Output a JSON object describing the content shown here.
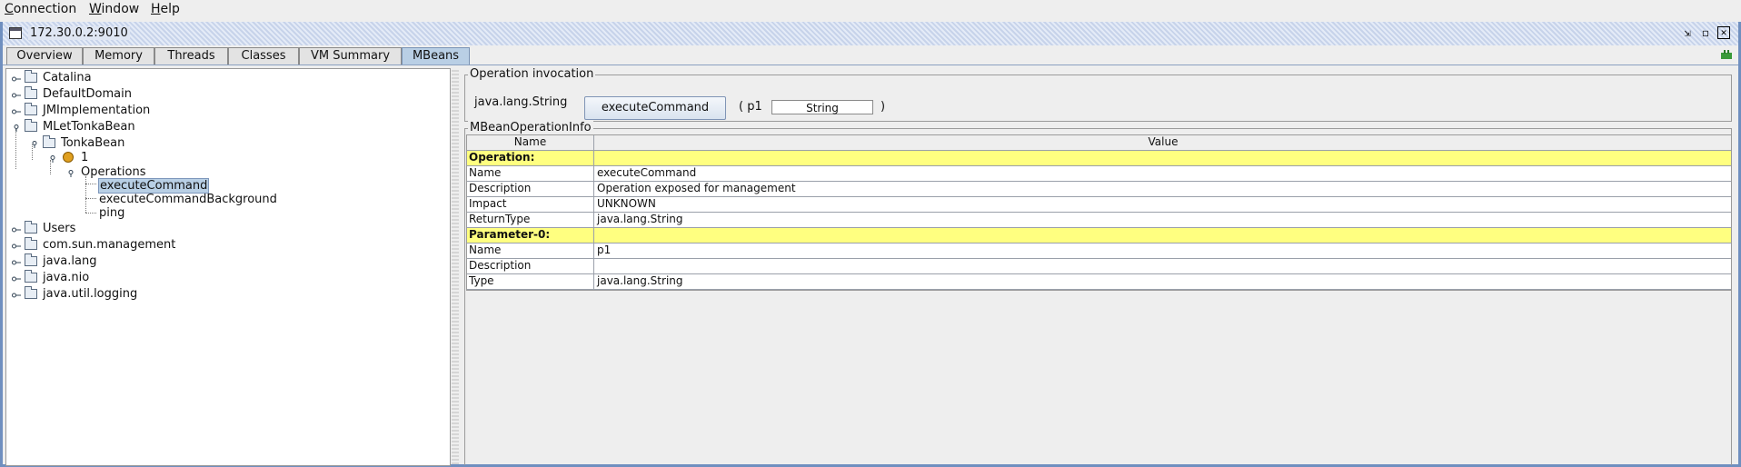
{
  "menubar": {
    "items": [
      "Connection",
      "Window",
      "Help"
    ]
  },
  "window": {
    "title": "172.30.0.2:9010"
  },
  "tabs": [
    "Overview",
    "Memory",
    "Threads",
    "Classes",
    "VM Summary",
    "MBeans"
  ],
  "selected_tab": "MBeans",
  "tree": {
    "catalina": "Catalina",
    "default_domain": "DefaultDomain",
    "jmimpl": "JMImplementation",
    "mlet": "MLetTonkaBean",
    "tonka": "TonkaBean",
    "one": "1",
    "operations": "Operations",
    "execute": "executeCommand",
    "execute_bg": "executeCommandBackground",
    "ping": "ping",
    "users": "Users",
    "com_sun": "com.sun.management",
    "java_lang": "java.lang",
    "java_nio": "java.nio",
    "java_util_logging": "java.util.logging"
  },
  "invocation": {
    "title": "Operation invocation",
    "return_type": "java.lang.String",
    "button_label": "executeCommand",
    "open": "( p1",
    "param_value": "String",
    "close": ")"
  },
  "info": {
    "title": "MBeanOperationInfo",
    "headers": [
      "Name",
      "Value"
    ],
    "rows": [
      [
        "Operation:",
        ""
      ],
      [
        "Name",
        "executeCommand"
      ],
      [
        "Description",
        "Operation exposed for management"
      ],
      [
        "Impact",
        "UNKNOWN"
      ],
      [
        "ReturnType",
        "java.lang.String"
      ],
      [
        "Parameter-0:",
        ""
      ],
      [
        "Name",
        "p1"
      ],
      [
        "Description",
        ""
      ],
      [
        "Type",
        "java.lang.String"
      ]
    ]
  },
  "colors": {
    "selection": "#b8cfe5",
    "section_highlight": "#ffff80",
    "frame_border": "#6f8fbf"
  }
}
